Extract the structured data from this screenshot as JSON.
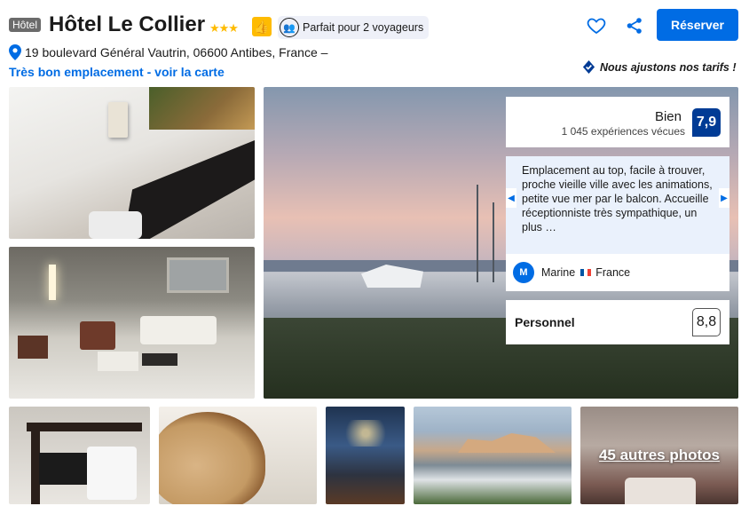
{
  "header": {
    "type_badge": "Hôtel",
    "title": "Hôtel Le Collier",
    "stars": "★★★",
    "traveler_pill": "Parfait pour 2 voyageurs",
    "reserve_label": "Réserver"
  },
  "address": {
    "text": "19 boulevard Général Vautrin, 06600 Antibes, France –",
    "location_link": "Très bon emplacement - voir la carte"
  },
  "price_note": "Nous ajustons nos tarifs !",
  "review": {
    "rating_label": "Bien",
    "rating_score": "7,9",
    "rating_count": "1 045 expériences vécues",
    "quote": "Emplacement au top, facile à trouver, proche vieille ville avec les animations, petite vue mer par le balcon. Accueille réceptionniste très sympathique, un plus …",
    "author_initial": "M",
    "author_name": "Marine",
    "author_country": "France",
    "category_label": "Personnel",
    "category_score": "8,8"
  },
  "gallery": {
    "more_photos": "45 autres photos"
  },
  "colors": {
    "brand_blue": "#006ce4",
    "score_navy": "#003b95",
    "star_yellow": "#febb02"
  }
}
